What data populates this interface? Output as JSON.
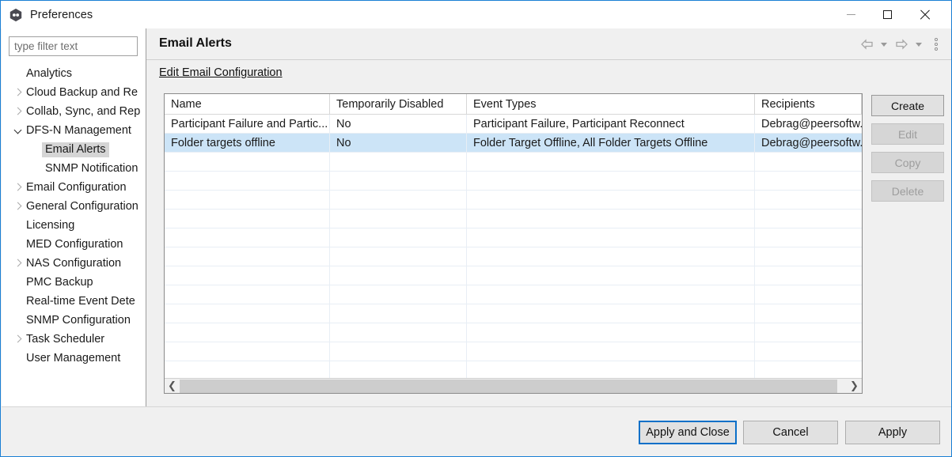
{
  "window": {
    "title": "Preferences",
    "icon": "app-hexagon-icon",
    "controls": {
      "minimize": "minimize",
      "maximize": "maximize",
      "close": "close"
    },
    "accent_color": "#1a7fd4"
  },
  "sidebar": {
    "filter": {
      "placeholder": "type filter text",
      "value": ""
    },
    "items": [
      {
        "label": "Analytics",
        "expander": "none",
        "indent": 0,
        "selected": false
      },
      {
        "label": "Cloud Backup and Re",
        "expander": "collapsed",
        "indent": 0,
        "selected": false
      },
      {
        "label": "Collab, Sync, and Rep",
        "expander": "collapsed",
        "indent": 0,
        "selected": false
      },
      {
        "label": "DFS-N Management",
        "expander": "expanded",
        "indent": 0,
        "selected": false
      },
      {
        "label": "Email Alerts",
        "expander": "none",
        "indent": 1,
        "selected": true
      },
      {
        "label": "SNMP Notification",
        "expander": "none",
        "indent": 1,
        "selected": false
      },
      {
        "label": "Email Configuration",
        "expander": "collapsed",
        "indent": 0,
        "selected": false
      },
      {
        "label": "General Configuration",
        "expander": "collapsed",
        "indent": 0,
        "selected": false
      },
      {
        "label": "Licensing",
        "expander": "none",
        "indent": 0,
        "selected": false
      },
      {
        "label": "MED Configuration",
        "expander": "none",
        "indent": 0,
        "selected": false
      },
      {
        "label": "NAS Configuration",
        "expander": "collapsed",
        "indent": 0,
        "selected": false
      },
      {
        "label": "PMC Backup",
        "expander": "none",
        "indent": 0,
        "selected": false
      },
      {
        "label": "Real-time Event Dete",
        "expander": "none",
        "indent": 0,
        "selected": false
      },
      {
        "label": "SNMP Configuration",
        "expander": "none",
        "indent": 0,
        "selected": false
      },
      {
        "label": "Task Scheduler",
        "expander": "collapsed",
        "indent": 0,
        "selected": false
      },
      {
        "label": "User Management",
        "expander": "none",
        "indent": 0,
        "selected": false
      }
    ],
    "scroll_left_icon": "chevron-left-icon",
    "scroll_right_icon": "chevron-right-icon"
  },
  "page": {
    "title": "Email Alerts",
    "edit_link": "Edit Email Configuration",
    "nav": {
      "back_icon": "arrow-back-icon",
      "back_menu_icon": "chevron-down-icon",
      "forward_icon": "arrow-forward-icon",
      "forward_menu_icon": "chevron-down-icon",
      "overflow_icon": "vertical-dots-icon"
    }
  },
  "table": {
    "columns": [
      "Name",
      "Temporarily Disabled",
      "Event Types",
      "Recipients"
    ],
    "rows": [
      {
        "name": "Participant Failure and Partic...",
        "disabled": "No",
        "events": "Participant Failure, Participant Reconnect",
        "recipients": "Debrag@peersoftw..",
        "selected": false
      },
      {
        "name": "Folder targets offline",
        "disabled": "No",
        "events": "Folder Target Offline, All Folder Targets Offline",
        "recipients": "Debrag@peersoftw..",
        "selected": true
      }
    ],
    "empty_row_count": 12,
    "selection_color": "#cce4f7",
    "scroll_left_icon": "chevron-left-icon",
    "scroll_right_icon": "chevron-right-icon"
  },
  "side_buttons": [
    {
      "label": "Create",
      "enabled": true
    },
    {
      "label": "Edit",
      "enabled": false
    },
    {
      "label": "Copy",
      "enabled": false
    },
    {
      "label": "Delete",
      "enabled": false
    }
  ],
  "bottom_buttons": {
    "apply_and_close": "Apply and Close",
    "cancel": "Cancel",
    "apply": "Apply",
    "focus_color": "#0a70c8"
  }
}
